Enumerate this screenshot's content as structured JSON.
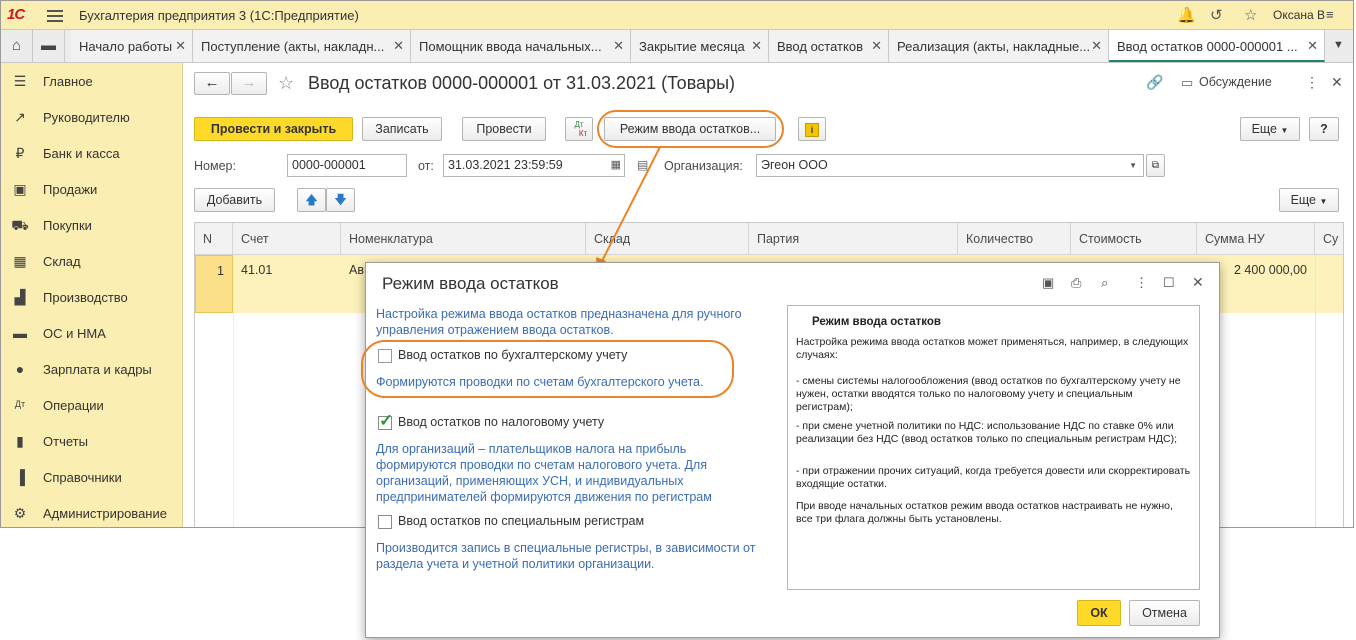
{
  "app": {
    "logo": "1С",
    "title": "Бухгалтерия предприятия 3  (1С:Предприятие)",
    "user": "Оксана В"
  },
  "tabs": [
    {
      "label": "Начало работы"
    },
    {
      "label": "Поступление (акты, накладн..."
    },
    {
      "label": "Помощник ввода начальных..."
    },
    {
      "label": "Закрытие месяца"
    },
    {
      "label": "Ввод остатков"
    },
    {
      "label": "Реализация (акты, накладные..."
    },
    {
      "label": "Ввод остатков 0000-000001 ..."
    }
  ],
  "sidebar": {
    "items": [
      {
        "label": "Главное",
        "icon": "menu-lines-icon"
      },
      {
        "label": "Руководителю",
        "icon": "trend-icon"
      },
      {
        "label": "Банк и касса",
        "icon": "ruble-icon"
      },
      {
        "label": "Продажи",
        "icon": "bag-icon"
      },
      {
        "label": "Покупки",
        "icon": "cart-icon"
      },
      {
        "label": "Склад",
        "icon": "grid-icon"
      },
      {
        "label": "Производство",
        "icon": "factory-icon"
      },
      {
        "label": "ОС и НМА",
        "icon": "truck-icon"
      },
      {
        "label": "Зарплата и кадры",
        "icon": "person-icon"
      },
      {
        "label": "Операции",
        "icon": "dt-kt-icon"
      },
      {
        "label": "Отчеты",
        "icon": "bar-chart-icon"
      },
      {
        "label": "Справочники",
        "icon": "book-icon"
      },
      {
        "label": "Администрирование",
        "icon": "gear-icon"
      }
    ]
  },
  "form": {
    "title": "Ввод остатков 0000-000001 от 31.03.2021 (Товары)",
    "discussion": "Обсуждение",
    "buttons": {
      "post_close": "Провести и закрыть",
      "save": "Записать",
      "post": "Провести",
      "dtkt_top": "Дт",
      "dtkt_bottom": "Кт",
      "mode": "Режим ввода остатков...",
      "more": "Еще",
      "help": "?",
      "add": "Добавить",
      "more2": "Еще"
    },
    "number_label": "Номер:",
    "number_value": "0000-000001",
    "date_label": "от:",
    "date_value": "31.03.2021 23:59:59",
    "org_label": "Организация:",
    "org_value": "Эгеон ООО"
  },
  "table": {
    "columns": [
      "N",
      "Счет",
      "Номенклатура",
      "Склад",
      "Партия",
      "Количество",
      "Стоимость",
      "Сумма НУ",
      "Су"
    ],
    "rows": [
      {
        "n": "1",
        "account": "41.01",
        "nomenclature": "Ав",
        "sum_nu": "2 400 000,00"
      }
    ]
  },
  "dialog": {
    "title": "Режим ввода остатков",
    "intro": "Настройка режима ввода остатков предназначена для ручного управления отражением  ввода остатков.",
    "options": [
      {
        "label": "Ввод остатков по бухгалтерскому учету",
        "checked": false,
        "desc": "Формируются проводки по счетам бухгалтерского учета."
      },
      {
        "label": "Ввод остатков по налоговому учету",
        "checked": true,
        "desc": "Для организаций – плательщиков налога на прибыль формируются проводки по счетам налогового учета. Для организаций, применяющих УСН, и  индивидуальных предпринимателей формируются движения по регистрам"
      },
      {
        "label": "Ввод остатков по специальным регистрам",
        "checked": false,
        "desc": "Производится запись в специальные регистры, в зависимости от раздела учета и учетной политики организации."
      }
    ],
    "help": {
      "heading": "Режим ввода остатков",
      "p1": "Настройка режима ввода остатков может применяться, например, в следующих случаях:",
      "p2": "- смены системы налогообложения (ввод остатков по бухгалтерскому учету не нужен, остатки вводятся только по налоговому учету и специальным регистрам);",
      "p3": "- при смене учетной политики по НДС: использование НДС по ставке 0% или реализации без НДС (ввод остатков только по специальным регистрам НДС);",
      "p4": "- при отражении прочих ситуаций, когда требуется довести или скорректировать входящие остатки.",
      "p5": "При вводе начальных остатков режим ввода остатков настраивать не нужно, все три флага должны быть установлены."
    },
    "ok": "ОК",
    "cancel": "Отмена"
  },
  "colors": {
    "accent_yellow": "#fed928",
    "sidebar_bg": "#fbeeb3",
    "link_blue": "#3b6db5",
    "highlight_orange": "#e8852a",
    "active_tab_line": "#1e8a5c"
  }
}
